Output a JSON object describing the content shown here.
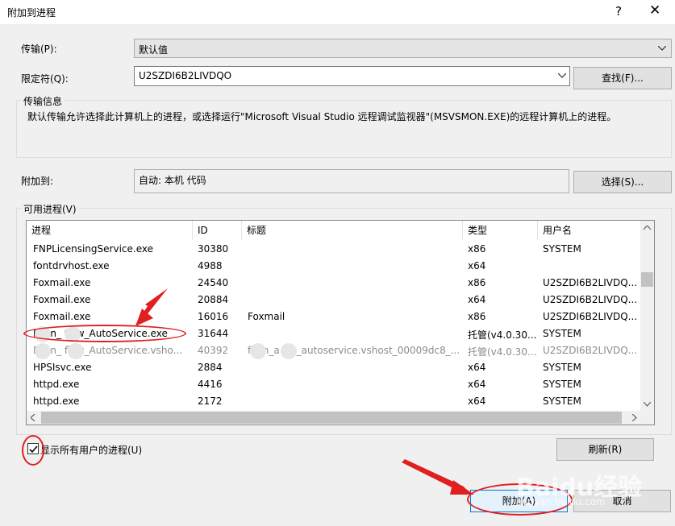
{
  "window": {
    "title": "附加到进程",
    "help_glyph": "?",
    "close_glyph": "✕"
  },
  "transport": {
    "label": "传输(P):",
    "value": "默认值"
  },
  "qualifier": {
    "label": "限定符(Q):",
    "value": "U2SZDI6B2LIVDQO",
    "find_button": "查找(F)..."
  },
  "transport_info": {
    "legend": "传输信息",
    "text": "默认传输允许选择此计算机上的进程，或选择运行\"Microsoft Visual Studio 远程调试监视器\"(MSVSMON.EXE)的远程计算机上的进程。"
  },
  "attach_to": {
    "label": "附加到:",
    "value": "自动: 本机 代码",
    "select_button": "选择(S)..."
  },
  "available": {
    "legend": "可用进程(V)",
    "columns": [
      "进程",
      "ID",
      "标题",
      "类型",
      "用户名"
    ],
    "rows": [
      {
        "process": "FNPLicensingService.exe",
        "id": "30380",
        "title": "",
        "type": "x86",
        "user": "SYSTEM",
        "dim": false
      },
      {
        "process": "fontdrvhost.exe",
        "id": "4988",
        "title": "",
        "type": "x64",
        "user": "",
        "dim": false
      },
      {
        "process": "Foxmail.exe",
        "id": "24540",
        "title": "",
        "type": "x86",
        "user": "U2SZDI6B2LIVDQ...",
        "dim": false
      },
      {
        "process": "Foxmail.exe",
        "id": "20884",
        "title": "",
        "type": "x64",
        "user": "U2SZDI6B2LIVDQ...",
        "dim": false
      },
      {
        "process": "Foxmail.exe",
        "id": "16016",
        "title": "Foxmail",
        "type": "x86",
        "user": "U2SZDI6B2LIVDQ...",
        "dim": false
      },
      {
        "process": "F    ion_  flow_AutoService.exe",
        "id": "31644",
        "title": "",
        "type": "托管(v4.0.30...",
        "user": "SYSTEM",
        "dim": false
      },
      {
        "process": "F    ion_  flow_AutoService.vsho...",
        "id": "40392",
        "title": "f     ion_a    ow_autoservice.vshost_00009dc8_...",
        "type": "托管(v4.0.30...",
        "user": "U2SZDI6B2LIVDQ...",
        "dim": true
      },
      {
        "process": "HPSIsvc.exe",
        "id": "2884",
        "title": "",
        "type": "x64",
        "user": "SYSTEM",
        "dim": false
      },
      {
        "process": "httpd.exe",
        "id": "4416",
        "title": "",
        "type": "x64",
        "user": "SYSTEM",
        "dim": false
      },
      {
        "process": "httpd.exe",
        "id": "2172",
        "title": "",
        "type": "x64",
        "user": "SYSTEM",
        "dim": false
      }
    ]
  },
  "show_all": {
    "label": "显示所有用户的进程(U)",
    "checked": true
  },
  "refresh_button": "刷新(R)",
  "attach_button": "附加(A)",
  "cancel_button": "取消",
  "watermark": "Baidu经验",
  "watermark_url": "jingyan.baidu.com"
}
